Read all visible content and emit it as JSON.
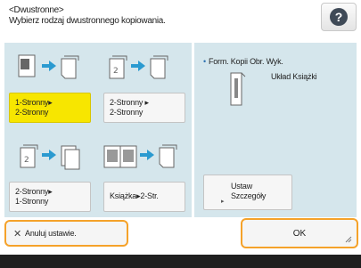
{
  "header": {
    "line1": "<Dwustronne>",
    "line2": "Wybierz rodzaj dwustronnego kopiowania."
  },
  "help": {
    "glyph": "?"
  },
  "options": [
    {
      "line1": "1-Stronny▸",
      "line2": "2-Stronny",
      "selected": true
    },
    {
      "line1": "2-Stronny ▸",
      "line2": "2-Stronny",
      "selected": false
    },
    {
      "line1": "2-Stronny▸",
      "line2": "1-Stronny",
      "selected": false
    },
    {
      "line1": "Książka▸2-Str.",
      "selected": false
    }
  ],
  "settings": {
    "title": "Form. Kopii Obr. Wyk.",
    "value": "Układ Książki",
    "detail_line1": "Ustaw",
    "detail_line2": "Szczegóły"
  },
  "cancel": {
    "label": "Anuluj ustawie."
  },
  "ok": {
    "label": "OK"
  },
  "colors": {
    "selected": "#f7e600",
    "panel": "#d5e6ec",
    "accent": "#f5a22a",
    "arrow": "#2a9ad0"
  }
}
